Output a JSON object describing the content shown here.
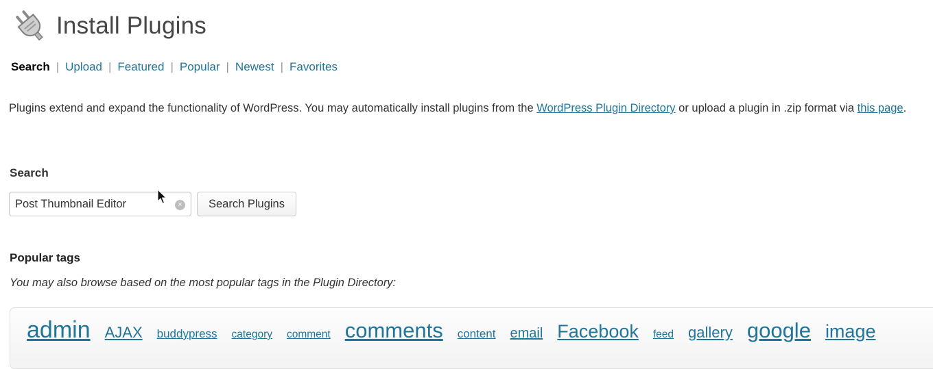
{
  "header": {
    "icon": "plugin-plug-icon",
    "title": "Install Plugins"
  },
  "subnav": {
    "items": [
      {
        "label": "Search",
        "current": true
      },
      {
        "label": "Upload",
        "current": false
      },
      {
        "label": "Featured",
        "current": false
      },
      {
        "label": "Popular",
        "current": false
      },
      {
        "label": "Newest",
        "current": false
      },
      {
        "label": "Favorites",
        "current": false
      }
    ],
    "separator": "|"
  },
  "intro": {
    "text_before": "Plugins extend and expand the functionality of WordPress. You may automatically install plugins from the ",
    "directory_link": "WordPress Plugin Directory",
    "text_middle": " or upload a plugin in .zip format via ",
    "page_link": "this page",
    "text_after": "."
  },
  "search": {
    "heading": "Search",
    "input_value": "Post Thumbnail Editor",
    "clear_icon": "clear-icon",
    "button_label": "Search Plugins"
  },
  "popular_tags": {
    "heading": "Popular tags",
    "description": "You may also browse based on the most popular tags in the Plugin Directory:",
    "tags": [
      {
        "label": "admin",
        "size": 34
      },
      {
        "label": "AJAX",
        "size": 22
      },
      {
        "label": "buddypress",
        "size": 17
      },
      {
        "label": "category",
        "size": 15.5
      },
      {
        "label": "comment",
        "size": 15.5
      },
      {
        "label": "comments",
        "size": 31
      },
      {
        "label": "content",
        "size": 17
      },
      {
        "label": "email",
        "size": 20
      },
      {
        "label": "Facebook",
        "size": 27
      },
      {
        "label": "feed",
        "size": 15.5
      },
      {
        "label": "gallery",
        "size": 22
      },
      {
        "label": "google",
        "size": 31
      },
      {
        "label": "image",
        "size": 27
      }
    ]
  },
  "colors": {
    "link": "#21759b",
    "title": "#464646",
    "text": "#333333"
  }
}
